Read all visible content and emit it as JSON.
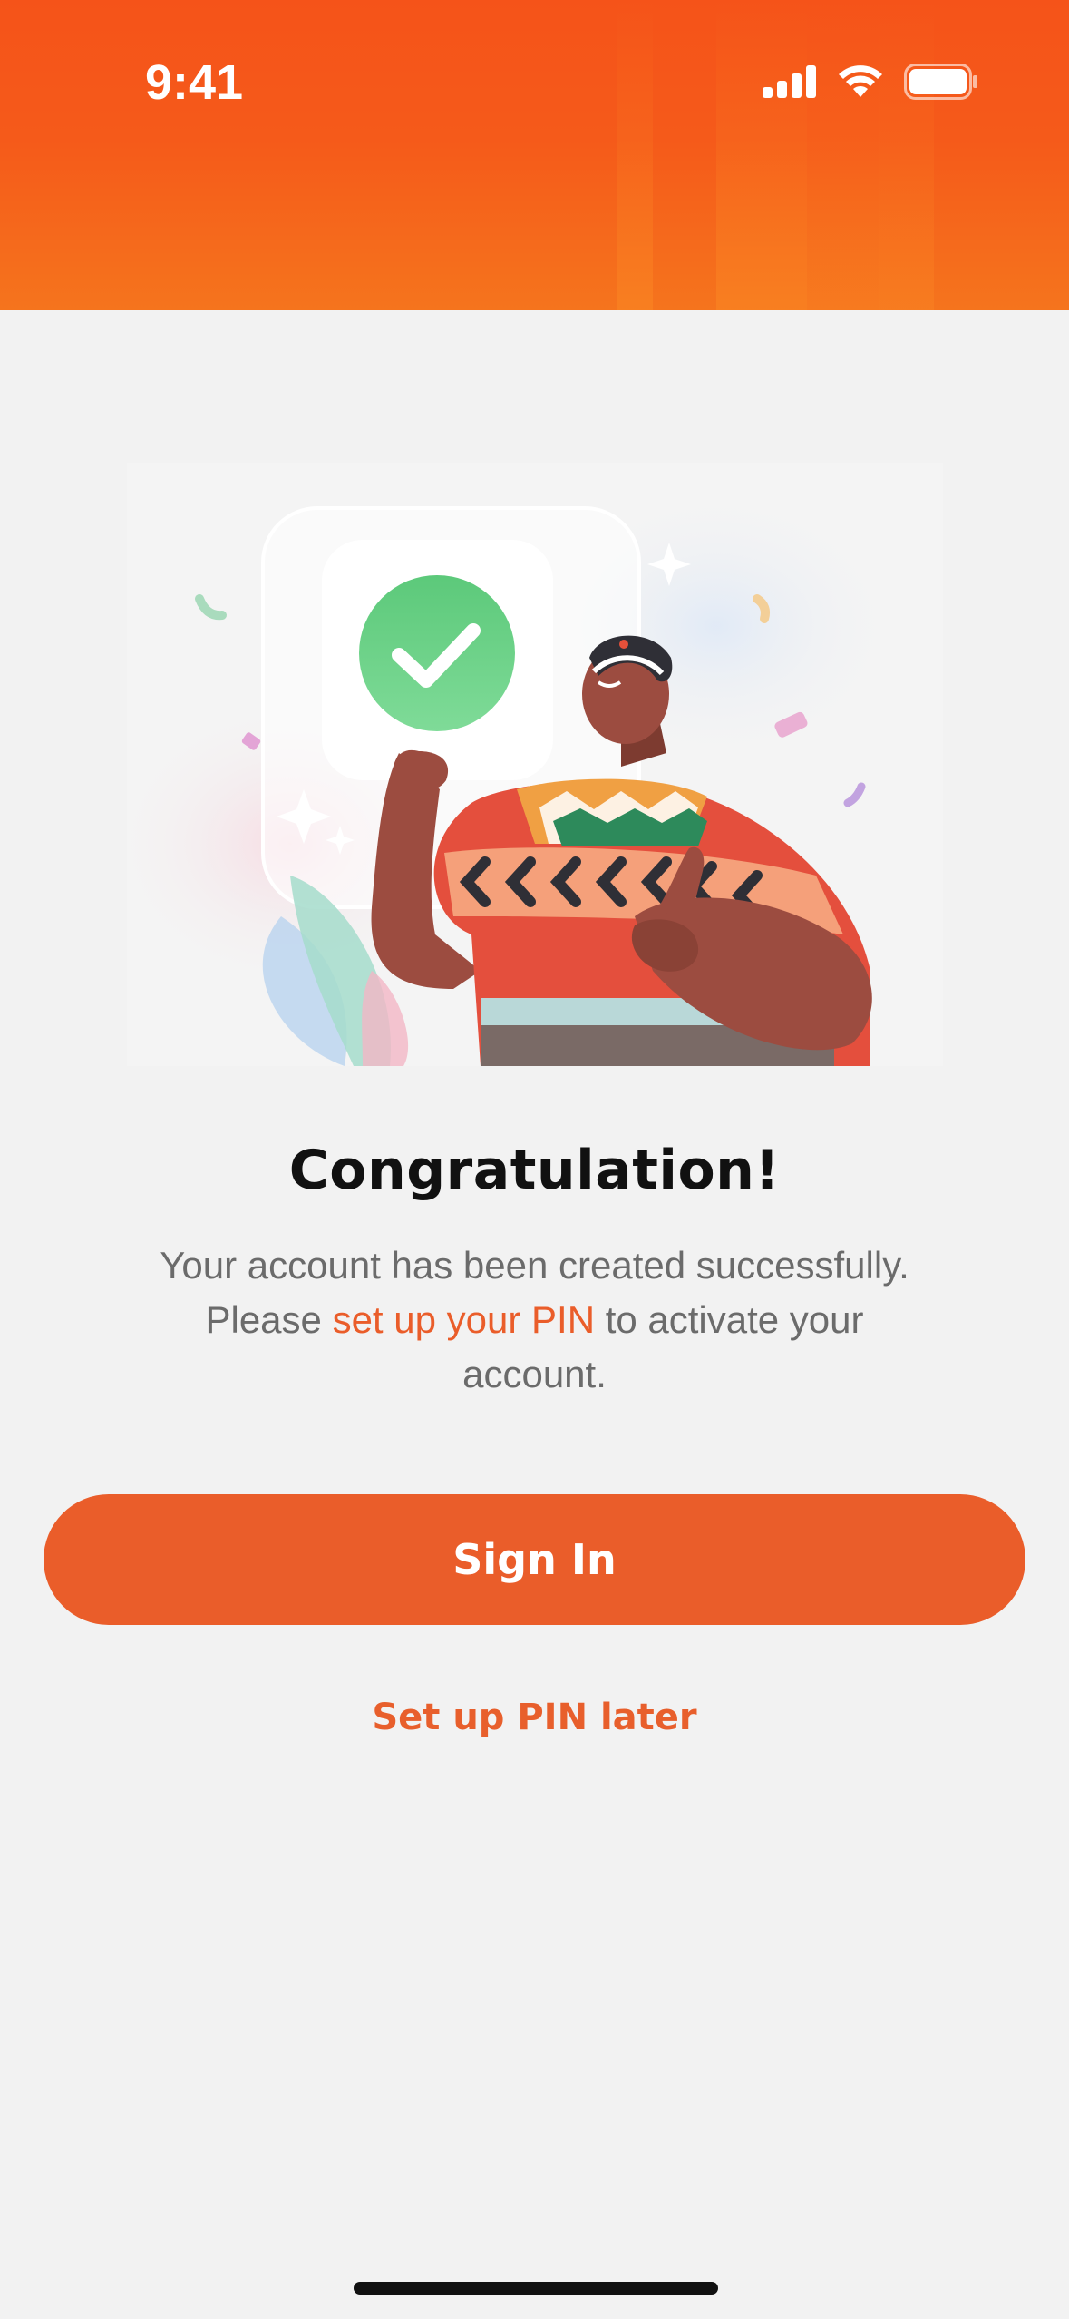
{
  "status_bar": {
    "time": "9:41",
    "icons": [
      "cellular-signal-icon",
      "wifi-icon",
      "battery-icon"
    ]
  },
  "colors": {
    "header": "#f55319",
    "accent": "#ea5d2a",
    "success": "#5cc97a"
  },
  "illustration": {
    "description_icon": "success-check-illustration"
  },
  "content": {
    "title": "Congratulation!",
    "line1": "Your account has been created successfully.",
    "line2_prefix": "Please ",
    "line2_link": "set up your PIN",
    "line2_suffix": " to activate your",
    "line3": "account."
  },
  "actions": {
    "sign_in_label": "Sign In",
    "setup_later_label": "Set up PIN later"
  }
}
